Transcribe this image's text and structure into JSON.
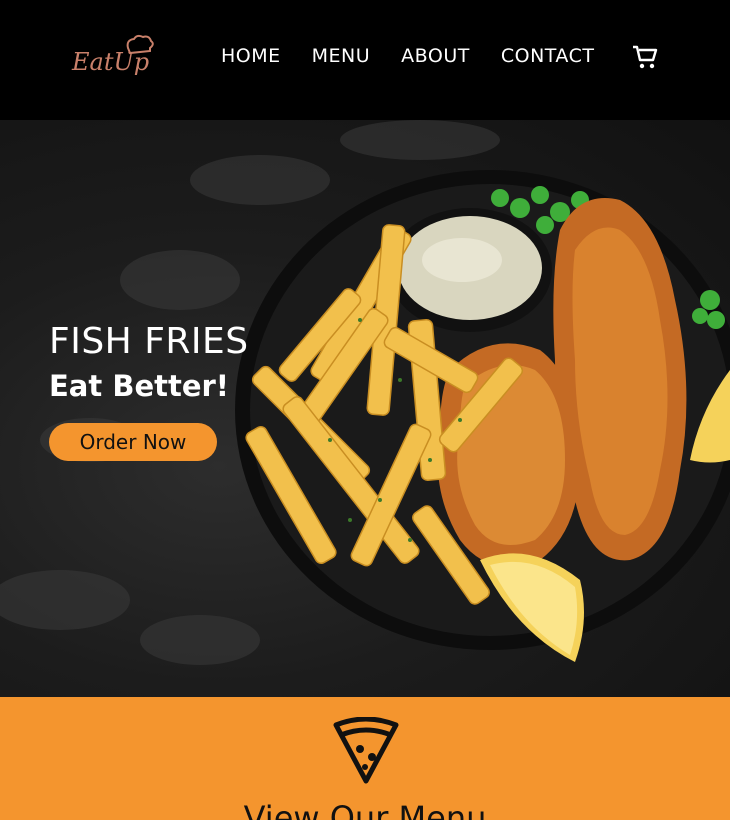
{
  "header": {
    "logo_text": "EatUp",
    "nav": [
      {
        "label": "HOME"
      },
      {
        "label": "MENU"
      },
      {
        "label": "ABOUT"
      },
      {
        "label": "CONTACT"
      }
    ],
    "cart_icon": "shopping-cart-icon"
  },
  "hero": {
    "title": "FISH FRIES",
    "subtitle": "Eat Better!",
    "cta_label": "Order Now",
    "image_icon": "fish-and-chips-image"
  },
  "menu_section": {
    "icon": "pizza-slice-icon",
    "heading": "View Our Menu"
  },
  "colors": {
    "accent": "#f4952e",
    "header_bg": "#000000",
    "logo": "#c9806a",
    "text_light": "#ffffff"
  }
}
